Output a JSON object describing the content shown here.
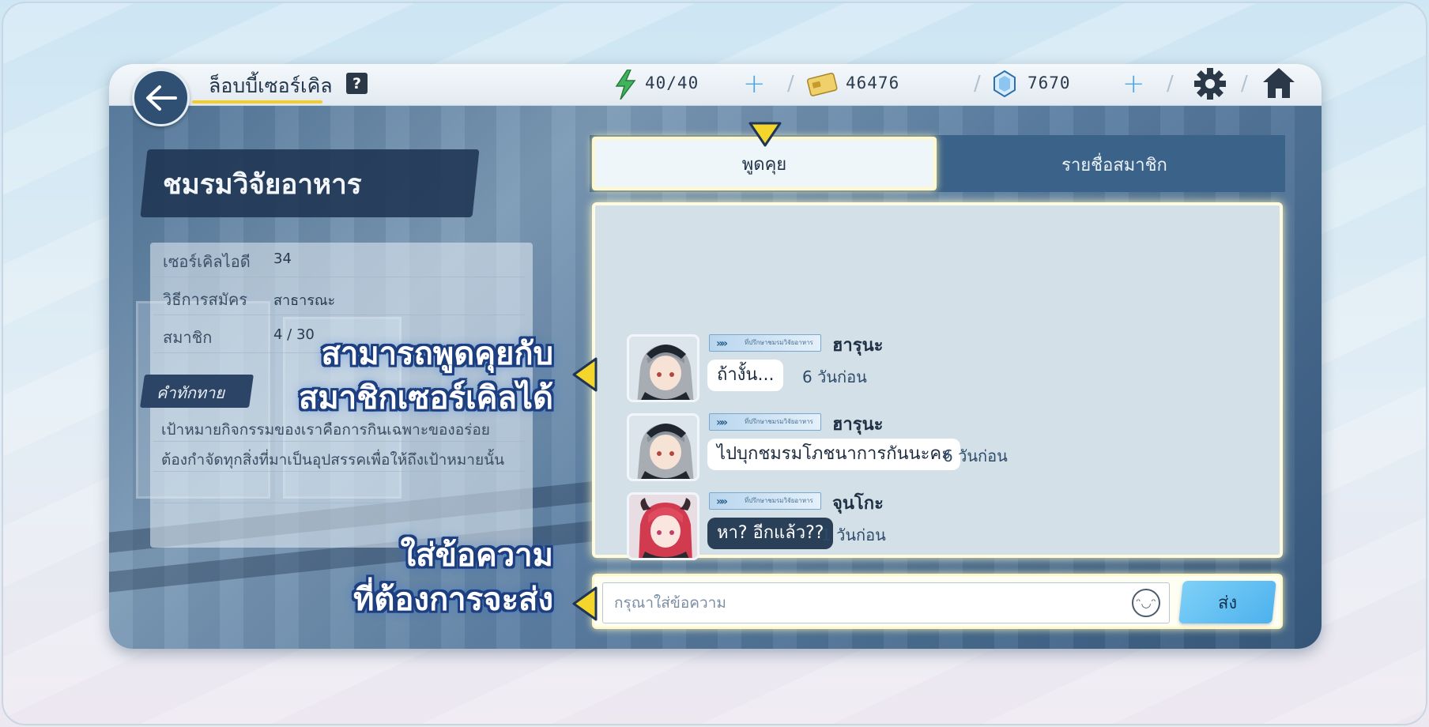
{
  "topbar": {
    "back_icon": "arrow-left-icon",
    "title": "ล็อบบี้เซอร์เคิล",
    "help_label": "?",
    "stamina": "40/40",
    "credits": "46476",
    "pyroxene": "7670",
    "settings_icon": "gear-icon",
    "home_icon": "home-icon"
  },
  "club": {
    "name": "ชมรมวิจัยอาหาร",
    "rows": [
      {
        "label": "เซอร์เคิลไอดี",
        "value": "34"
      },
      {
        "label": "วิธีการสมัคร",
        "value": "สาธารณะ"
      },
      {
        "label": "สมาชิก",
        "value": "4 / 30"
      }
    ],
    "greeting_label": "คำทักทาย",
    "greeting_lines": [
      "เป้าหมายกิจกรรมของเราคือการกินเฉพาะของอร่อย",
      "ต้องกำจัดทุกสิ่งที่มาเป็นอุปสรรคเพื่อให้ถึงเป้าหมายนั้น"
    ]
  },
  "tabs": {
    "chat": "พูดคุย",
    "members": "รายชื่อสมาชิก"
  },
  "messages": [
    {
      "role": "ที่ปรึกษาชมรมวิจัยอาหาร",
      "sender": "ฮารุนะ",
      "text": "ถ้างั้น...",
      "time": "6 วันก่อน",
      "style": "light"
    },
    {
      "role": "ที่ปรึกษาชมรมวิจัยอาหาร",
      "sender": "ฮารุนะ",
      "text": "ไปบุกชมรมโภชนาการกันนะคะ",
      "time": "6 วันก่อน",
      "style": "light"
    },
    {
      "role": "ที่ปรึกษาชมรมวิจัยอาหาร",
      "sender": "จุนโกะ",
      "text": "หา? อีกแล้ว??",
      "time": "1 วันก่อน",
      "style": "dark"
    }
  ],
  "input": {
    "placeholder": "กรุณาใส่ข้อความ",
    "emoji": "ᵔ◡ᵔ",
    "send_label": "ส่ง"
  },
  "annotations": {
    "chat_line1": "สามารถพูดคุยกับ",
    "chat_line2": "สมาชิกเซอร์เคิลได้",
    "input_line1": "ใส่ข้อความ",
    "input_line2": "ที่ต้องการจะส่ง"
  },
  "colors": {
    "accent_yellow": "#f2cd2b",
    "navy": "#2f4f73",
    "send_blue": "#4db2ee",
    "annotation_outline": "#1d3f80"
  }
}
